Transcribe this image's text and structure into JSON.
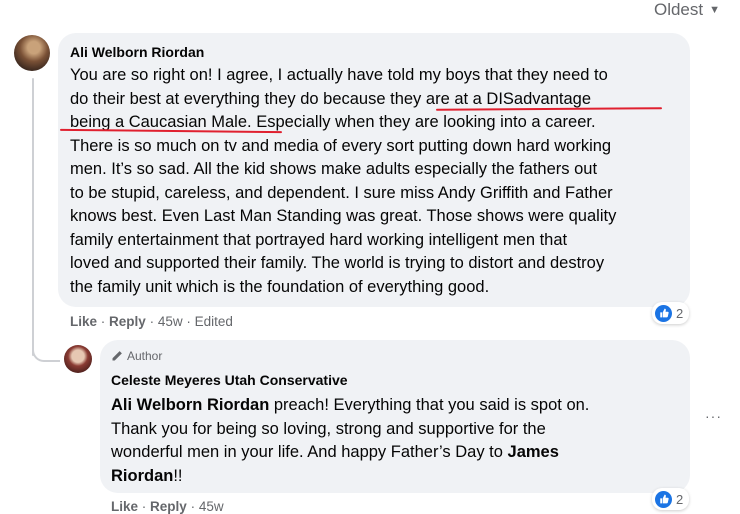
{
  "sort": {
    "label": "Oldest"
  },
  "comment1": {
    "author": "Ali Welborn Riordan",
    "lines": [
      "You are so right on! I agree, I actually have told my boys that they need to",
      "do their best at everything they do because they are at a DISadvantage",
      "being a Caucasian Male. Especially when they are looking into a career.",
      "There is so much on tv and media of every sort putting down hard working",
      "men. It’s so sad. All the kid shows make adults especially the fathers out",
      "to be stupid, careless, and dependent. I sure miss Andy Griffith and Father",
      "knows best. Even Last Man Standing was great. Those shows were quality",
      "family entertainment that portrayed hard working intelligent men that",
      "loved and supported their family. The world is trying to distort and destroy",
      "the family unit which is the foundation of everything good."
    ],
    "actions": {
      "like": "Like",
      "reply": "Reply",
      "time": "45w",
      "edited": "Edited",
      "sep": "·"
    },
    "reaction_count": "2",
    "underline_color": "#e0202f"
  },
  "comment2": {
    "badge": "Author",
    "author": "Celeste Meyeres Utah Conservative",
    "mention": "Ali Welborn Riordan",
    "text_part1": " preach! Everything that you said is spot on.",
    "line2": "Thank you for being so loving, strong and supportive for the",
    "line3_prefix": "wonderful men in your life. And happy Father’s Day to ",
    "mention2": "James",
    "line4_mention": "Riordan",
    "line4_suffix": "!!",
    "actions": {
      "like": "Like",
      "reply": "Reply",
      "time": "45w",
      "sep": "·"
    },
    "reaction_count": "2"
  },
  "colors": {
    "bubble": "#f0f2f5",
    "like_blue": "#1b74e4",
    "muted": "#65676b"
  }
}
